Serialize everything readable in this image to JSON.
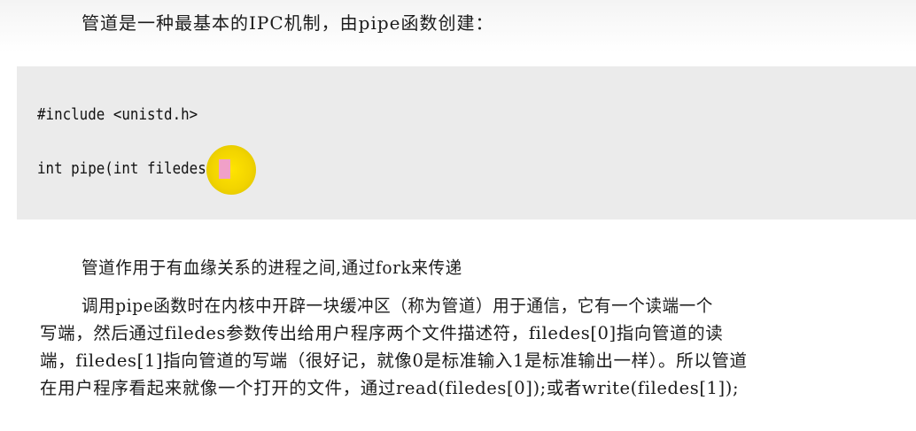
{
  "intro": "管道是一种最基本的IPC机制，由pipe函数创建：",
  "code": {
    "line1": "#include <unistd.h>",
    "line2": "int pipe(int filedes[2]);"
  },
  "paragraphs": [
    "管道作用于有血缘关系的进程之间,通过fork来传递",
    "调用pipe函数时在内核中开辟一块缓冲区（称为管道）用于通信，它有一个读端一个",
    "写端，然后通过filedes参数传出给用户程序两个文件描述符，filedes[0]指向管道的读",
    "端，filedes[1]指向管道的写端（很好记，就像0是标准输入1是标准输出一样）。所以管道",
    "在用户程序看起来就像一个打开的文件，通过read(filedes[0]);或者write(filedes[1]);"
  ]
}
